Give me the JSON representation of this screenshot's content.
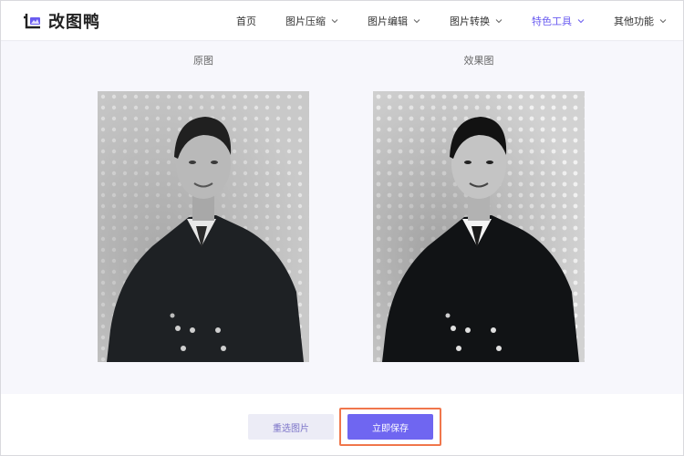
{
  "brand": {
    "name": "改图鸭",
    "accent_color": "#6a5cf0"
  },
  "nav": {
    "items": [
      {
        "label": "首页",
        "has_dropdown": false,
        "active": false
      },
      {
        "label": "图片压缩",
        "has_dropdown": true,
        "active": false
      },
      {
        "label": "图片编辑",
        "has_dropdown": true,
        "active": false
      },
      {
        "label": "图片转换",
        "has_dropdown": true,
        "active": false
      },
      {
        "label": "特色工具",
        "has_dropdown": true,
        "active": true
      },
      {
        "label": "其他功能",
        "has_dropdown": true,
        "active": false
      }
    ]
  },
  "compare": {
    "original_label": "原图",
    "result_label": "效果图"
  },
  "actions": {
    "reselect_label": "重选图片",
    "save_label": "立即保存",
    "save_color": "#6f66f1",
    "highlight_color": "#f0764b"
  }
}
